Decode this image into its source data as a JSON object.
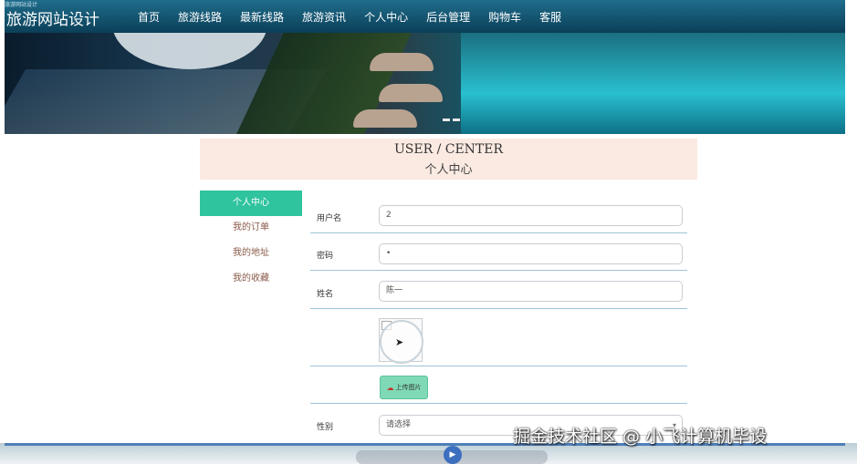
{
  "header": {
    "caption": "旅游网站设计",
    "title": "旅游网站设计",
    "nav": [
      "首页",
      "旅游线路",
      "最新线路",
      "旅游资讯",
      "个人中心",
      "后台管理",
      "购物车",
      "客服"
    ]
  },
  "user_center": {
    "title_en": "USER / CENTER",
    "title_cn": "个人中心"
  },
  "sidebar": {
    "items": [
      {
        "label": "个人中心",
        "active": true
      },
      {
        "label": "我的订单",
        "active": false
      },
      {
        "label": "我的地址",
        "active": false
      },
      {
        "label": "我的收藏",
        "active": false
      }
    ]
  },
  "form": {
    "username_label": "用户名",
    "username_value": "2",
    "password_label": "密码",
    "password_value": "•",
    "name_label": "姓名",
    "name_value": "陈一",
    "upload_label": "上传图片",
    "gender_label": "性别",
    "gender_placeholder": "请选择"
  },
  "watermark": "掘金技术社区 @ 小飞计算机毕设",
  "colors": {
    "topbar": "#0b3f58",
    "active": "#2fc49e",
    "header_bg": "#fbeae2",
    "upload_btn": "#7fd9b6"
  },
  "icons": {
    "upload": "cloud-upload-icon",
    "cursor": "mouse-cursor-icon",
    "select": "chevron-down-icon"
  }
}
